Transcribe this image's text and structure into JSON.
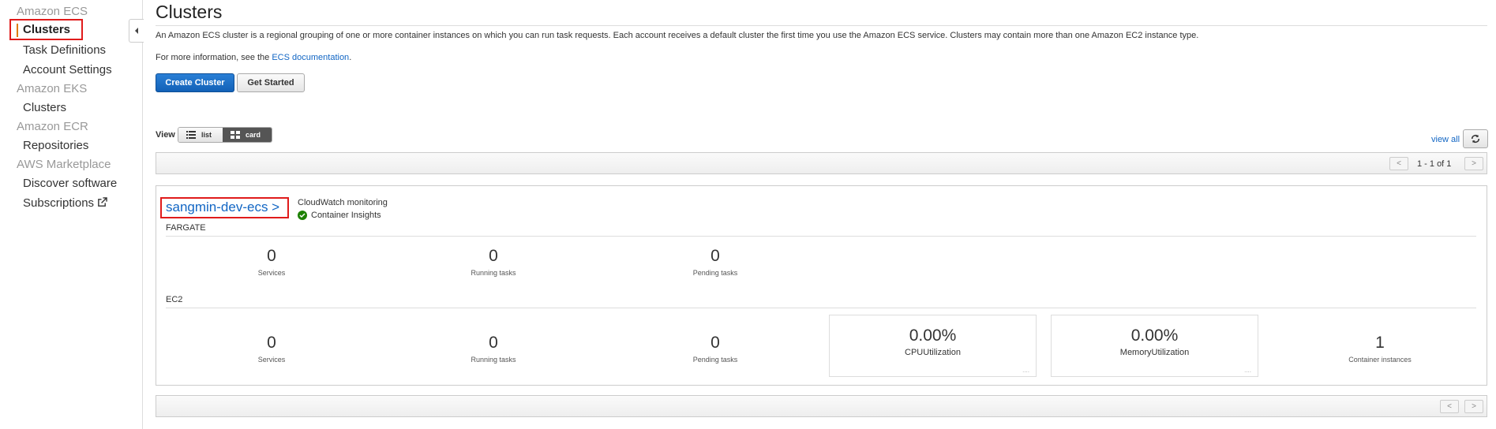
{
  "sidebar": {
    "sections": [
      {
        "label": "Amazon ECS",
        "items": [
          {
            "label": "Clusters",
            "active": true
          },
          {
            "label": "Task Definitions"
          },
          {
            "label": "Account Settings"
          }
        ]
      },
      {
        "label": "Amazon EKS",
        "items": [
          {
            "label": "Clusters"
          }
        ]
      },
      {
        "label": "Amazon ECR",
        "items": [
          {
            "label": "Repositories"
          }
        ]
      },
      {
        "label": "AWS Marketplace",
        "items": [
          {
            "label": "Discover software"
          },
          {
            "label": "Subscriptions",
            "icon": "external-link-icon"
          }
        ]
      }
    ],
    "collapse_icon": "caret-left-icon"
  },
  "page": {
    "title": "Clusters",
    "description": "An Amazon ECS cluster is a regional grouping of one or more container instances on which you can run task requests. Each account receives a default cluster the first time you use the Amazon ECS service. Clusters may contain more than one Amazon EC2 instance type.",
    "info_prefix": "For more information, see the ",
    "info_link": "ECS documentation",
    "info_suffix": ".",
    "create_button": "Create Cluster",
    "get_started_button": "Get Started"
  },
  "view": {
    "label": "View",
    "list_label": "list",
    "card_label": "card",
    "selected": "card",
    "view_all": "view all",
    "refresh_icon": "refresh-icon"
  },
  "pager": {
    "prev": "<",
    "next": ">",
    "range": "1 - 1 of 1"
  },
  "cluster": {
    "name": "sangmin-dev-ecs >",
    "cloudwatch_label": "CloudWatch monitoring",
    "insights_label": "Container Insights",
    "fargate": {
      "label": "FARGATE",
      "services": {
        "value": "0",
        "label": "Services"
      },
      "running": {
        "value": "0",
        "label": "Running tasks"
      },
      "pending": {
        "value": "0",
        "label": "Pending tasks"
      }
    },
    "ec2": {
      "label": "EC2",
      "services": {
        "value": "0",
        "label": "Services"
      },
      "running": {
        "value": "0",
        "label": "Running tasks"
      },
      "pending": {
        "value": "0",
        "label": "Pending tasks"
      },
      "cpu": {
        "value": "0.00%",
        "label": "CPUUtilization",
        "dots": "...."
      },
      "memory": {
        "value": "0.00%",
        "label": "MemoryUtilization",
        "dots": "...."
      },
      "instances": {
        "value": "1",
        "label": "Container instances"
      }
    }
  },
  "colors": {
    "accent": "#1266c4",
    "highlight": "#e01b1b",
    "success": "#1d8102"
  }
}
